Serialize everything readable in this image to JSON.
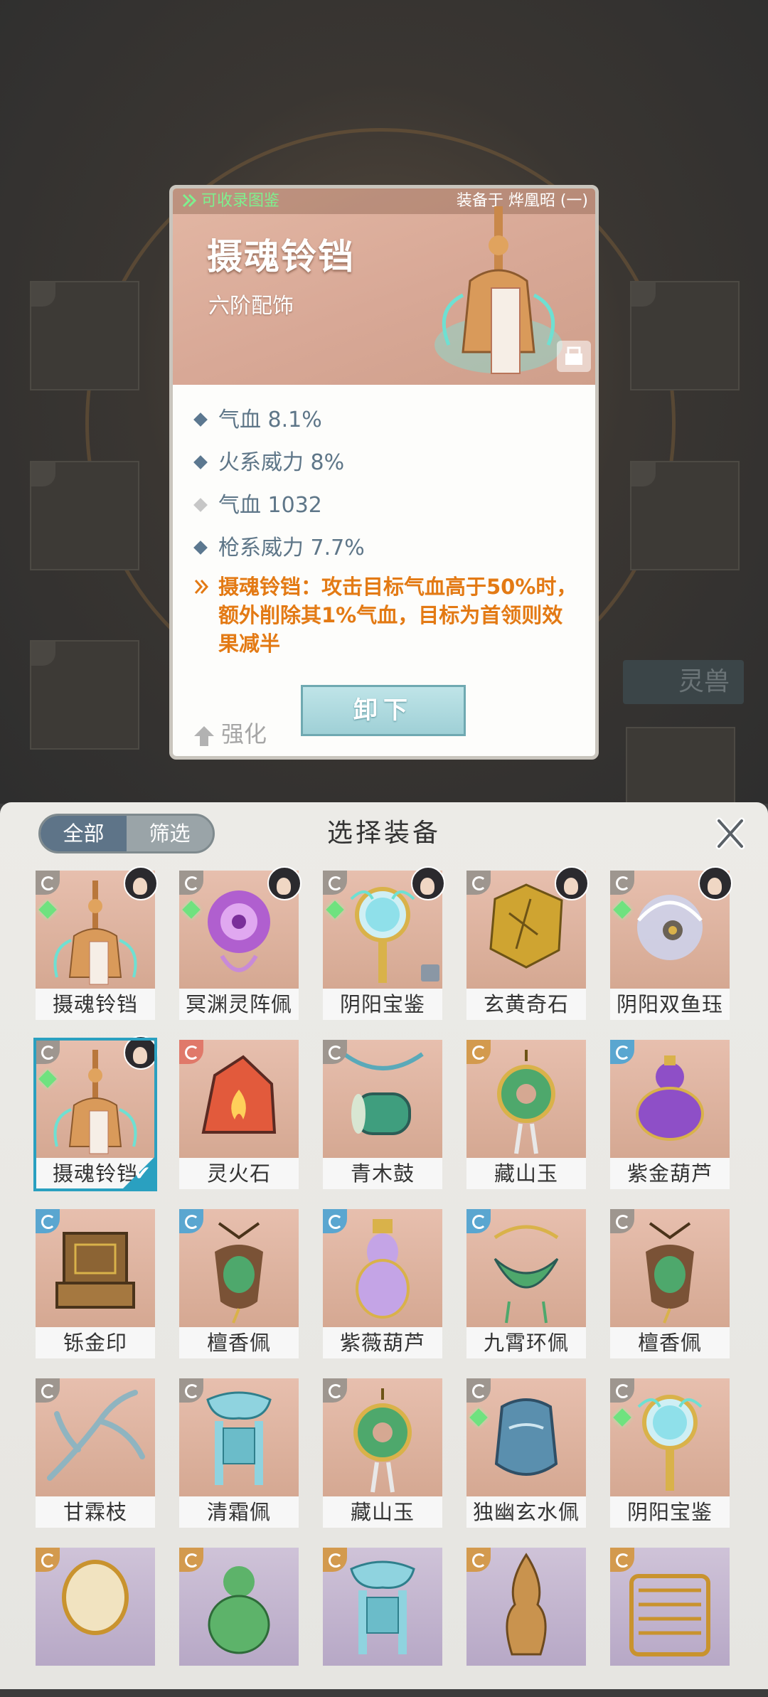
{
  "background": {
    "side_tab_label": "灵兽"
  },
  "item_card": {
    "collect_label": "可收录图鉴",
    "equipped_label": "装备于 烨凰昭 (一)",
    "name": "摄魂铃铛",
    "grade": "六阶配饰",
    "stats": [
      {
        "text": "气血 8.1%",
        "style": "normal"
      },
      {
        "text": "火系威力 8%",
        "style": "normal"
      },
      {
        "text": "气血 1032",
        "style": "grey"
      },
      {
        "text": "枪系威力 7.7%",
        "style": "normal"
      }
    ],
    "special_effect": "摄魂铃铛：攻击目标气血高于50%时，额外削除其1%气血，目标为首领则效果减半",
    "strengthen_label": "强化",
    "unequip_label": "卸下"
  },
  "panel": {
    "title": "选择装备",
    "filter_all": "全部",
    "filter_screen": "筛选",
    "items": [
      {
        "name": "摄魂铃铛",
        "cat": "grey",
        "gem": true,
        "avatar": true,
        "art": "bell"
      },
      {
        "name": "冥渊灵阵佩",
        "cat": "grey",
        "gem": true,
        "avatar": true,
        "art": "orb-purple"
      },
      {
        "name": "阴阳宝鉴",
        "cat": "grey",
        "gem": true,
        "avatar": true,
        "art": "mirror",
        "lock": true
      },
      {
        "name": "玄黄奇石",
        "cat": "grey",
        "gem": false,
        "avatar": true,
        "art": "stone-gold"
      },
      {
        "name": "阴阳双鱼珏",
        "cat": "grey",
        "gem": true,
        "avatar": true,
        "art": "orb-swirl"
      },
      {
        "name": "摄魂铃铛",
        "cat": "grey",
        "gem": true,
        "avatar": true,
        "art": "bell",
        "selected": true
      },
      {
        "name": "灵火石",
        "cat": "red",
        "gem": false,
        "avatar": false,
        "art": "fire-stone"
      },
      {
        "name": "青木鼓",
        "cat": "grey",
        "gem": false,
        "avatar": false,
        "art": "drum"
      },
      {
        "name": "藏山玉",
        "cat": "gold",
        "gem": false,
        "avatar": false,
        "art": "jade-ring"
      },
      {
        "name": "紫金葫芦",
        "cat": "blue",
        "gem": false,
        "avatar": false,
        "art": "gourd-purple"
      },
      {
        "name": "铄金印",
        "cat": "blue",
        "gem": false,
        "avatar": false,
        "art": "seal"
      },
      {
        "name": "檀香佩",
        "cat": "blue",
        "gem": false,
        "avatar": false,
        "art": "pendant-green"
      },
      {
        "name": "紫薇葫芦",
        "cat": "blue",
        "gem": false,
        "avatar": false,
        "art": "vase-purple"
      },
      {
        "name": "九霄环佩",
        "cat": "blue",
        "gem": false,
        "avatar": false,
        "art": "ring-green"
      },
      {
        "name": "檀香佩",
        "cat": "grey",
        "gem": false,
        "avatar": false,
        "art": "pendant-green"
      },
      {
        "name": "甘霖枝",
        "cat": "grey",
        "gem": false,
        "avatar": false,
        "art": "branch"
      },
      {
        "name": "清霜佩",
        "cat": "grey",
        "gem": false,
        "avatar": false,
        "art": "frost"
      },
      {
        "name": "藏山玉",
        "cat": "grey",
        "gem": false,
        "avatar": false,
        "art": "jade-ring"
      },
      {
        "name": "独幽玄水佩",
        "cat": "grey",
        "gem": true,
        "avatar": false,
        "art": "jar-blue"
      },
      {
        "name": "阴阳宝鉴",
        "cat": "grey",
        "gem": true,
        "avatar": false,
        "art": "mirror"
      },
      {
        "name": "",
        "cat": "gold",
        "gem": false,
        "avatar": false,
        "art": "mirror-gold",
        "purple": true
      },
      {
        "name": "",
        "cat": "gold",
        "gem": false,
        "avatar": false,
        "art": "gourd-green",
        "purple": true
      },
      {
        "name": "",
        "cat": "gold",
        "gem": false,
        "avatar": false,
        "art": "frost",
        "purple": true
      },
      {
        "name": "",
        "cat": "gold",
        "gem": false,
        "avatar": false,
        "art": "flame-bronze",
        "purple": true
      },
      {
        "name": "",
        "cat": "gold",
        "gem": false,
        "avatar": false,
        "art": "coil",
        "purple": true
      }
    ]
  }
}
